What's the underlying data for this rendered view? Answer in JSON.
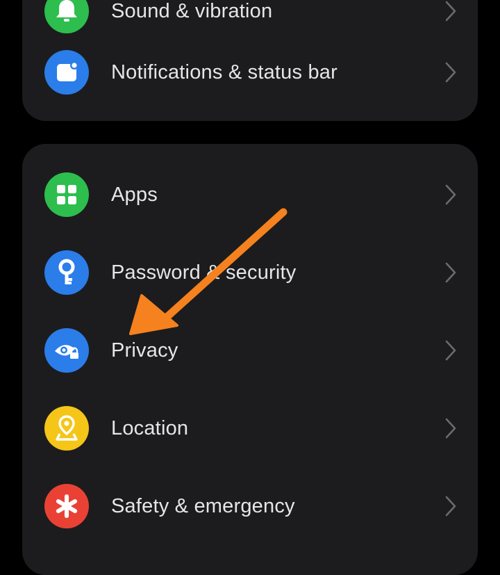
{
  "settings": {
    "top_card": [
      {
        "label": "Sound & vibration",
        "icon": "bell-icon",
        "color": "#2dbe4e"
      },
      {
        "label": "Notifications & status bar",
        "icon": "notification-icon",
        "color": "#2b7de9"
      }
    ],
    "main_card": [
      {
        "label": "Apps",
        "icon": "apps-grid-icon",
        "color": "#2dbe4e"
      },
      {
        "label": "Password & security",
        "icon": "key-icon",
        "color": "#2b7de9"
      },
      {
        "label": "Privacy",
        "icon": "privacy-eye-lock-icon",
        "color": "#2b7de9"
      },
      {
        "label": "Location",
        "icon": "location-pin-icon",
        "color": "#f5c518"
      },
      {
        "label": "Safety & emergency",
        "icon": "asterisk-icon",
        "color": "#e94235"
      }
    ]
  },
  "annotation": {
    "icon": "orange-arrow-icon",
    "color": "#f5821f",
    "points_to": "Privacy"
  }
}
